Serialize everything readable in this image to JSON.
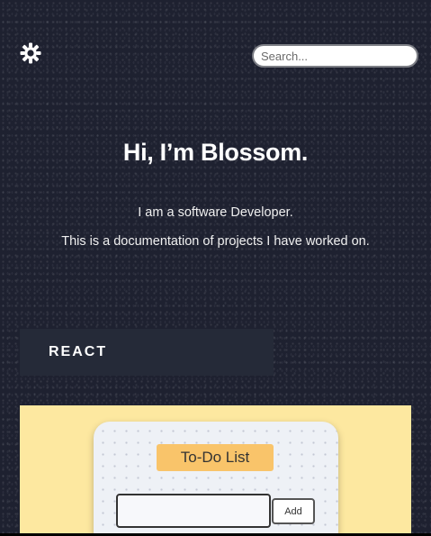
{
  "header": {
    "theme_icon": "sun-icon",
    "search_placeholder": "Search..."
  },
  "hero": {
    "title": "Hi, I’m Blossom.",
    "line1": "I am a software Developer.",
    "line2": "This is a documentation of projects I have worked on."
  },
  "categories": [
    {
      "label": "REACT"
    }
  ],
  "project_preview": {
    "title": "To-Do List",
    "add_label": "Add"
  },
  "colors": {
    "background": "#1e2130",
    "tab_background": "#252a38",
    "card_background": "#fde8a0",
    "todo_title_background": "#f9c46a"
  }
}
